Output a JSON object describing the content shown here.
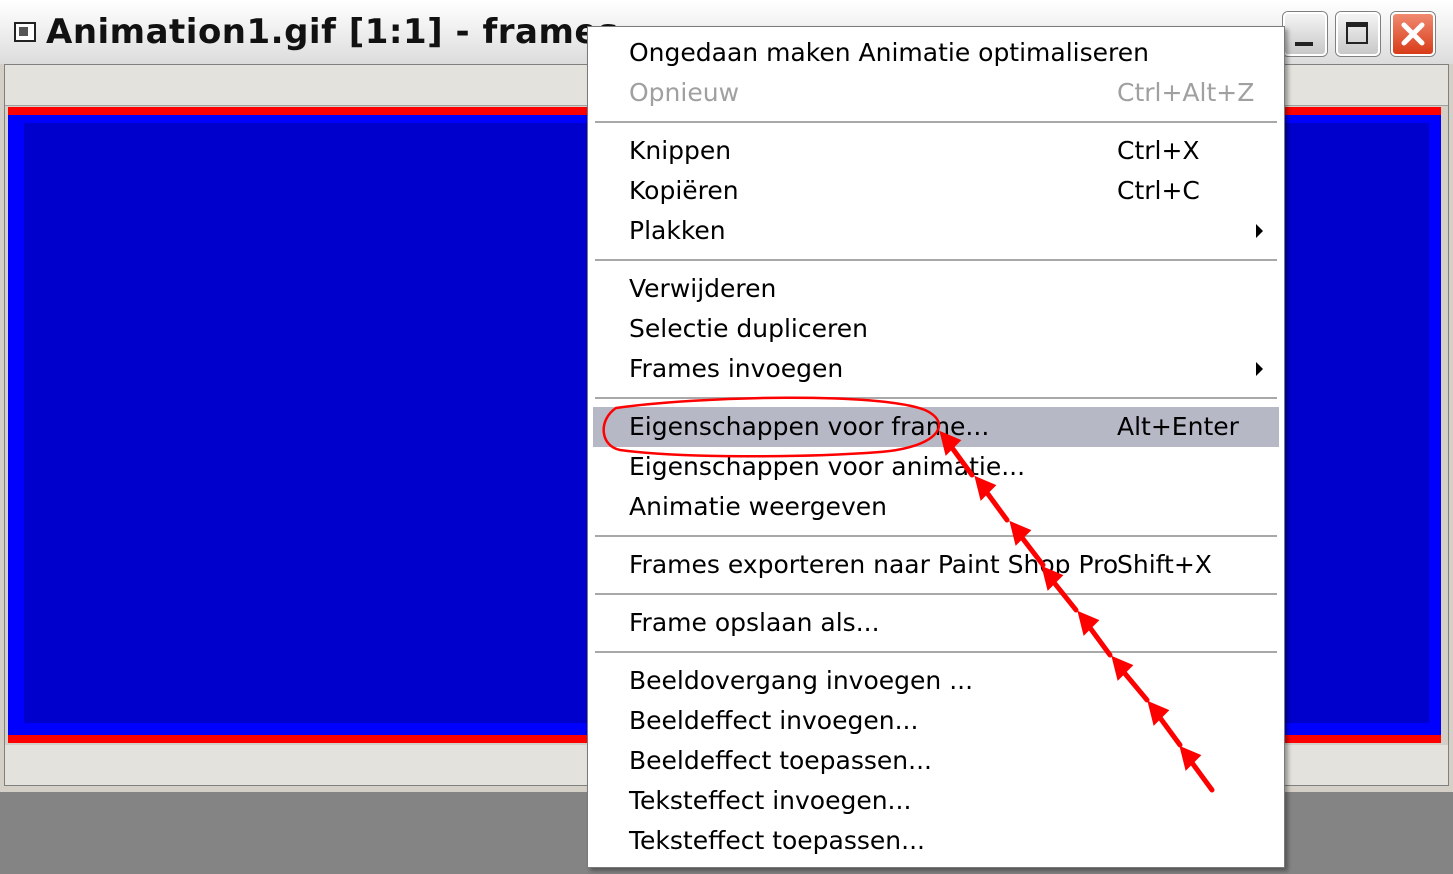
{
  "window": {
    "title": "Animation1.gif [1:1] - frames",
    "app_icon": "animation-shop-document-icon",
    "controls": {
      "minimize_icon": "minimize-icon",
      "maximize_icon": "maximize-icon",
      "close_icon": "close-icon"
    }
  },
  "canvas": {
    "frame_colors": {
      "border": "#ff0000",
      "fill": "#0000ff",
      "inner": "#0000cc"
    }
  },
  "context_menu": {
    "items": [
      {
        "label": "Ongedaan maken Animatie optimaliseren",
        "shortcut": ""
      },
      {
        "label": "Opnieuw",
        "shortcut": "Ctrl+Alt+Z",
        "disabled": true
      },
      {
        "label": "Knippen",
        "shortcut": "Ctrl+X"
      },
      {
        "label": "Kopiëren",
        "shortcut": "Ctrl+C"
      },
      {
        "label": "Plakken",
        "shortcut": "",
        "submenu": true
      },
      {
        "label": "Verwijderen",
        "shortcut": ""
      },
      {
        "label": "Selectie dupliceren",
        "shortcut": ""
      },
      {
        "label": "Frames invoegen",
        "shortcut": "",
        "submenu": true
      },
      {
        "label": "Eigenschappen voor frame...",
        "shortcut": "Alt+Enter",
        "selected": true
      },
      {
        "label": "Eigenschappen voor animatie...",
        "shortcut": ""
      },
      {
        "label": "Animatie weergeven",
        "shortcut": ""
      },
      {
        "label": "Frames exporteren naar Paint Shop Pro",
        "shortcut": "Shift+X"
      },
      {
        "label": "Frame opslaan als...",
        "shortcut": ""
      },
      {
        "label": "Beeldovergang invoegen ...",
        "shortcut": ""
      },
      {
        "label": "Beeldeffect invoegen...",
        "shortcut": ""
      },
      {
        "label": "Beeldeffect toepassen...",
        "shortcut": ""
      },
      {
        "label": "Teksteffect invoegen...",
        "shortcut": ""
      },
      {
        "label": "Teksteffect toepassen...",
        "shortcut": ""
      }
    ],
    "selected_color": "#b6b8c6"
  },
  "annotation": {
    "color": "#ff0000",
    "target": "Eigenschappen voor frame...",
    "shapes": [
      "ellipse-circle",
      "dashed-arrow"
    ]
  }
}
